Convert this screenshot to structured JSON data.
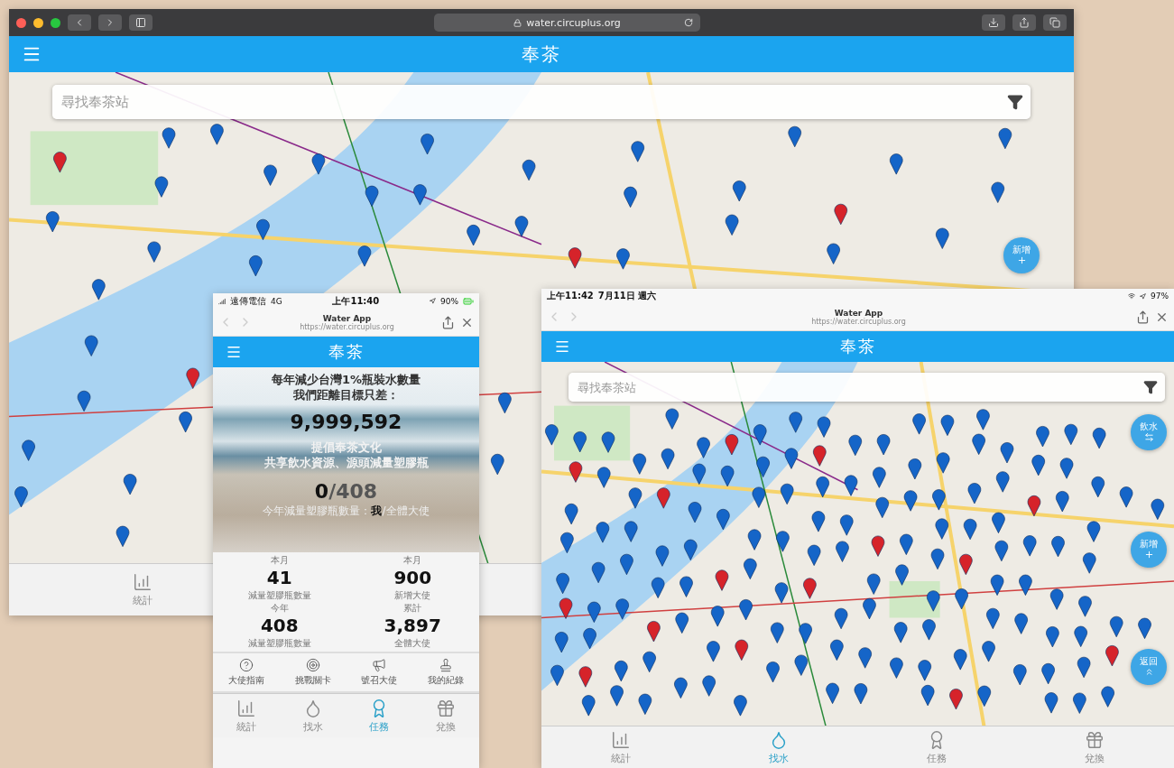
{
  "desktop": {
    "url": "water.circuplus.org",
    "app_title": "奉茶",
    "search": {
      "placeholder": "尋找奉茶站"
    },
    "map_buttons": [
      {
        "label": "新增",
        "kind": "add"
      }
    ],
    "tabs": [
      {
        "label": "統計",
        "kind": "stats",
        "selected": false
      }
    ]
  },
  "phone": {
    "status": {
      "carrier": "遠傳電信",
      "network": "4G",
      "time": "上午11:40",
      "battery": "90%"
    },
    "browser": {
      "title": "Water App",
      "url": "https://water.circuplus.org"
    },
    "app_title": "奉茶",
    "hero": {
      "headline": [
        "每年減少台灣1%瓶裝水數量",
        "我們距離目標只差："
      ],
      "count": "9,999,592",
      "slogan": [
        "提倡奉茶文化",
        "共享飲水資源、源頭減量塑膠瓶"
      ],
      "progress": "**0**/408",
      "caption": "今年減量塑膠瓶數量：**我**/全體大使"
    },
    "stats": [
      {
        "period": "本月",
        "value": "41",
        "label": "減量塑膠瓶數量"
      },
      {
        "period": "本月",
        "value": "900",
        "label": "新增大使"
      },
      {
        "period": "今年",
        "value": "408",
        "label": "減量塑膠瓶數量"
      },
      {
        "period": "累計",
        "value": "3,897",
        "label": "全體大使"
      }
    ],
    "actions": [
      {
        "label": "大使指南",
        "kind": "guide"
      },
      {
        "label": "挑戰關卡",
        "kind": "challenge"
      },
      {
        "label": "號召大使",
        "kind": "recruit"
      },
      {
        "label": "我的紀錄",
        "kind": "record"
      }
    ],
    "tabs": [
      {
        "label": "統計",
        "kind": "stats",
        "selected": false
      },
      {
        "label": "找水",
        "kind": "water",
        "selected": false
      },
      {
        "label": "任務",
        "kind": "mission",
        "selected": true
      },
      {
        "label": "兌換",
        "kind": "gift",
        "selected": false
      }
    ]
  },
  "tablet": {
    "status": {
      "time": "上午11:42",
      "date": "7月11日 週六",
      "battery": "97%"
    },
    "browser": {
      "title": "Water App",
      "url": "https://water.circuplus.org"
    },
    "app_title": "奉茶",
    "search": {
      "placeholder": "尋找奉茶站"
    },
    "map_buttons": [
      {
        "label": "飲水",
        "kind": "swap"
      },
      {
        "label": "新增",
        "kind": "add"
      },
      {
        "label": "返回",
        "kind": "back"
      }
    ],
    "tabs": [
      {
        "label": "統計",
        "kind": "stats",
        "selected": false
      },
      {
        "label": "找水",
        "kind": "water",
        "selected": true
      },
      {
        "label": "任務",
        "kind": "mission",
        "selected": false
      },
      {
        "label": "兌換",
        "kind": "gift",
        "selected": false
      }
    ]
  }
}
